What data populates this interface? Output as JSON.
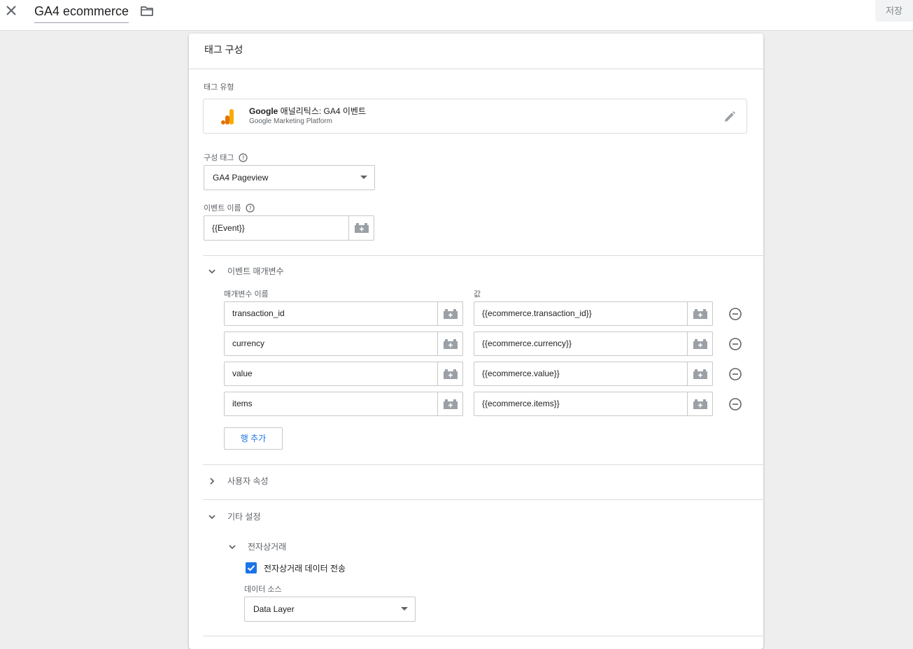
{
  "topbar": {
    "tag_name": "GA4 ecommerce",
    "save_label": "저장"
  },
  "card": {
    "title": "태그 구성",
    "tag_type": {
      "label": "태그 유형",
      "name_bold": "Google",
      "name_rest": " 애널리틱스: GA4 이벤트",
      "platform": "Google Marketing Platform"
    },
    "config_tag": {
      "label": "구성 태그",
      "value": "GA4 Pageview"
    },
    "event_name": {
      "label": "이벤트 이름",
      "value": "{{Event}}"
    },
    "event_params": {
      "title": "이벤트 매개변수",
      "col_name": "매개변수 이름",
      "col_value": "값",
      "rows": [
        {
          "name": "transaction_id",
          "value": "{{ecommerce.transaction_id}}"
        },
        {
          "name": "currency",
          "value": "{{ecommerce.currency}}"
        },
        {
          "name": "value",
          "value": "{{ecommerce.value}}"
        },
        {
          "name": "items",
          "value": "{{ecommerce.items}}"
        }
      ],
      "add_row_label": "행 추가"
    },
    "user_properties": {
      "title": "사용자 속성"
    },
    "more_settings": {
      "title": "기타 설정",
      "ecommerce": {
        "title": "전자상거래",
        "send_data_label": "전자상거래 데이터 전송",
        "send_data_checked": true,
        "data_source_label": "데이터 소스",
        "data_source_value": "Data Layer"
      }
    }
  },
  "colors": {
    "accent": "#1a73e8",
    "ga_orange": "#f9ab00",
    "ga_dark_orange": "#e37400"
  }
}
